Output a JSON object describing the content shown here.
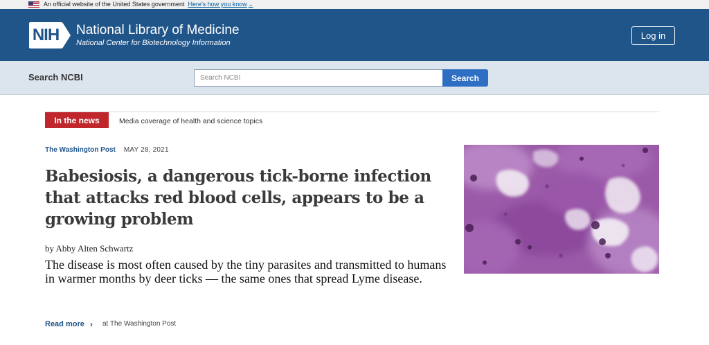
{
  "gov_banner": {
    "text": "An official website of the United States government",
    "link": "Here's how you know"
  },
  "header": {
    "logo_text": "NIH",
    "title": "National Library of Medicine",
    "subtitle": "National Center for Biotechnology Information",
    "login_label": "Log in",
    "background_color": "#20558a"
  },
  "search": {
    "label": "Search NCBI",
    "placeholder": "Search NCBI",
    "button_label": "Search",
    "button_color": "#2e6fc3"
  },
  "news": {
    "badge": "In the news",
    "badge_color": "#c0272d",
    "description": "Media coverage of health and science topics"
  },
  "article": {
    "source": "The Washington Post",
    "date": "MAY 28, 2021",
    "headline": "Babesiosis, a dangerous tick-borne infection that attacks red blood cells, appears to be a growing problem",
    "byline": "by Abby Alten Schwartz",
    "summary": "The disease is most often caused by the tiny parasites and transmitted to humans in warmer months by deer ticks — the same ones that spread Lyme disease.",
    "read_more": "Read more",
    "at_source": "at The Washington Post"
  }
}
